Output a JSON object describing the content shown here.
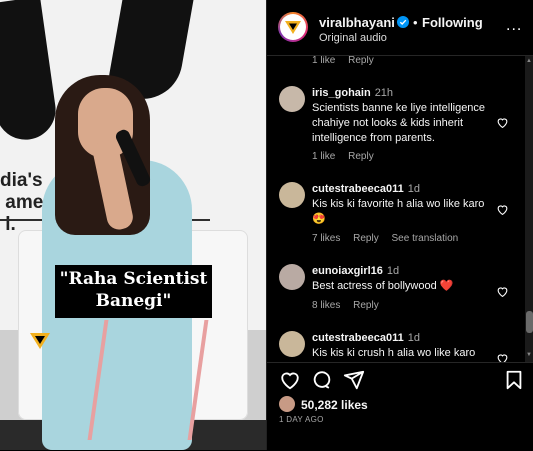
{
  "media": {
    "backdrop_text": "dia's\n amer        ns\n l.",
    "caption_line1": "\"Raha Scientist",
    "caption_line2": "Banegi\"",
    "watermark_logo_color": "#f2b01e"
  },
  "header": {
    "username": "viralbhayani",
    "separator": "•",
    "following_label": "Following",
    "audio_label": "Original audio",
    "more_label": "..."
  },
  "comments": [
    {
      "username": "",
      "time": "",
      "text": "",
      "meta": {
        "likes": "1 like",
        "reply": "Reply",
        "translation": ""
      }
    },
    {
      "username": "iris_gohain",
      "time": "21h",
      "text": "Scientists banne ke liye intelligence chahiye not looks & kids inherit intelligence from parents.",
      "meta": {
        "likes": "1 like",
        "reply": "Reply",
        "translation": ""
      }
    },
    {
      "username": "cutestrabeeca011",
      "time": "1d",
      "text": "Kis kis ki favorite h alia wo like karo 😍",
      "meta": {
        "likes": "7 likes",
        "reply": "Reply",
        "translation": "See translation"
      }
    },
    {
      "username": "eunoiaxgirl16",
      "time": "1d",
      "text": "Best actress of bollywood ❤️",
      "meta": {
        "likes": "8 likes",
        "reply": "Reply",
        "translation": ""
      }
    },
    {
      "username": "cutestrabeeca011",
      "time": "1d",
      "text": "Kis kis ki crush h alia wo like karo",
      "meta": {
        "likes": "",
        "reply": "",
        "translation": ""
      }
    }
  ],
  "footer": {
    "likes_count": "50,282 likes",
    "posted": "1 DAY AGO"
  },
  "colors": {
    "accent_blue": "#0095f6",
    "heart_red": "#ed4956"
  }
}
